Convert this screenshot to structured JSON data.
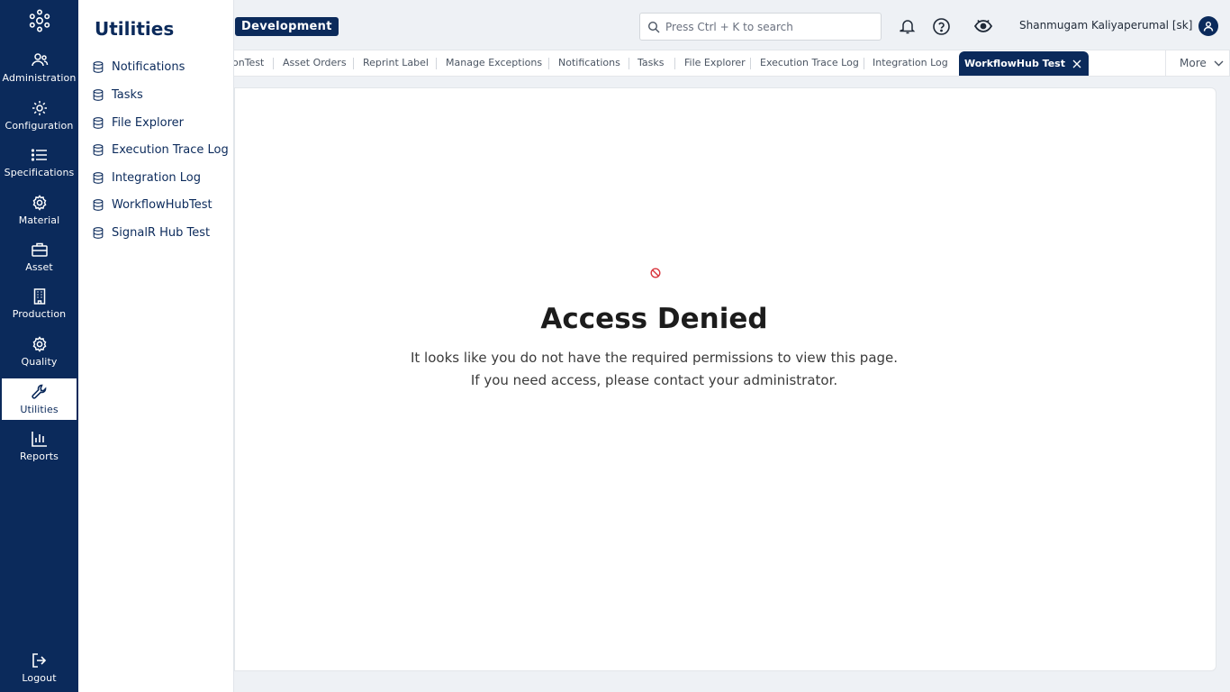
{
  "rail": {
    "items": [
      {
        "label": "Administration",
        "icon": "users-icon"
      },
      {
        "label": "Configuration",
        "icon": "gear-icon"
      },
      {
        "label": "Specifications",
        "icon": "list-icon"
      },
      {
        "label": "Material",
        "icon": "cog-icon"
      },
      {
        "label": "Asset",
        "icon": "toolbox-icon"
      },
      {
        "label": "Production",
        "icon": "building-icon"
      },
      {
        "label": "Quality",
        "icon": "badge-icon"
      },
      {
        "label": "Utilities",
        "icon": "wrench-icon",
        "active": true
      },
      {
        "label": "Reports",
        "icon": "bar-chart-icon"
      }
    ],
    "logout": "Logout"
  },
  "flyout": {
    "title": "Utilities",
    "items": [
      "Notifications",
      "Tasks",
      "File Explorer",
      "Execution Trace Log",
      "Integration Log",
      "WorkflowHubTest",
      "SignalR Hub Test"
    ]
  },
  "header": {
    "environment": "Development",
    "search_placeholder": "Press Ctrl + K to search",
    "user": "Shanmugam Kaliyaperumal [sk]"
  },
  "tabs": {
    "items": [
      "onTest",
      "Asset Orders",
      "Reprint Label",
      "Manage Exceptions",
      "Notifications",
      "Tasks",
      "File Explorer",
      "Execution Trace Log",
      "Integration Log"
    ],
    "active": "WorkflowHub Test",
    "more": "More"
  },
  "content": {
    "title": "Access Denied",
    "line1": "It looks like you do not have the required permissions to view this page.",
    "line2": "If you need access, please contact your administrator."
  },
  "colors": {
    "primary": "#0b2a5b",
    "denied_icon": "#d9363e"
  }
}
